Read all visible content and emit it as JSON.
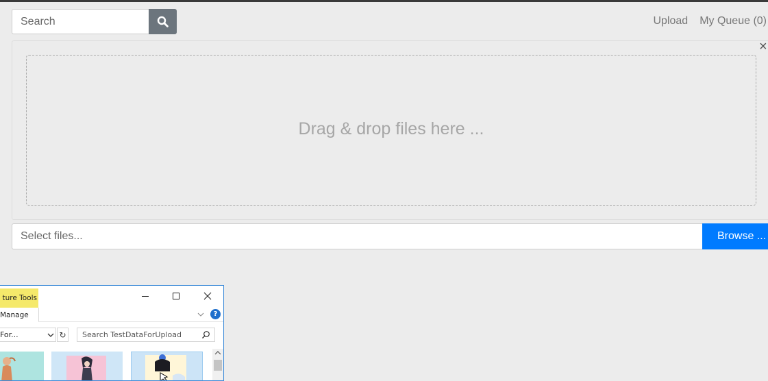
{
  "header": {
    "search_placeholder": "Search",
    "nav": {
      "upload": "Upload",
      "queue": "My Queue (0)"
    }
  },
  "dropzone": {
    "text": "Drag & drop files here ...",
    "close_symbol": "×"
  },
  "file_picker": {
    "placeholder": "Select files...",
    "browse_label": "Browse ..."
  },
  "explorer_dialog": {
    "ribbon_tab_context": "ture Tools",
    "ribbon_tab_manage": "Manage",
    "path_text": "For...",
    "search_placeholder": "Search TestDataForUpload",
    "help_symbol": "?",
    "refresh_symbol": "↻"
  },
  "colors": {
    "background": "#ececec",
    "search_button": "#6c757d",
    "browse_button": "#007bff",
    "dialog_border": "#3c8ad8",
    "picture_tools_tab": "#f5e96b"
  }
}
